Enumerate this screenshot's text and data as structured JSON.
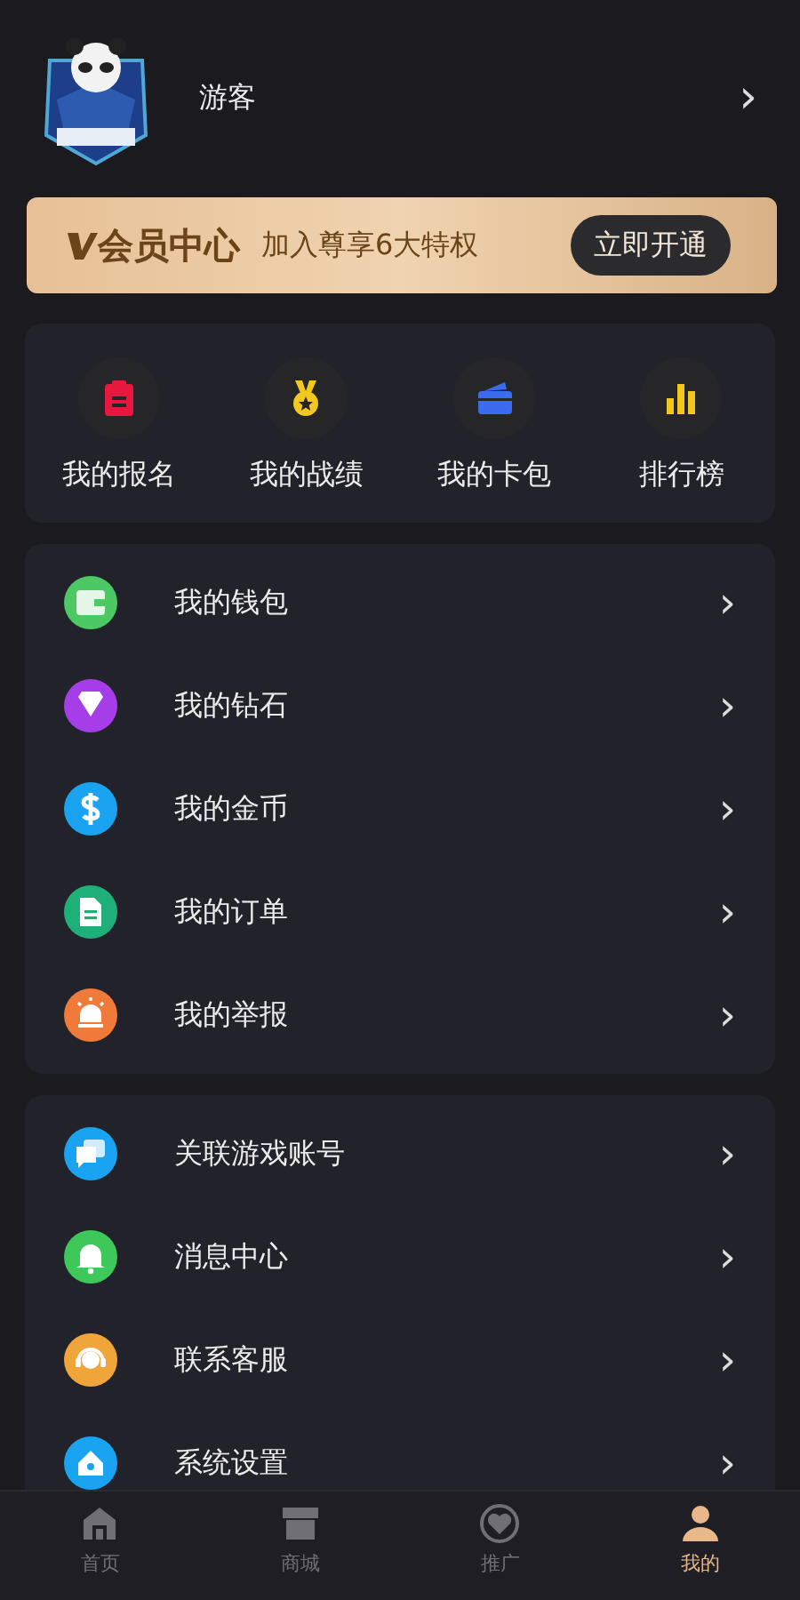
{
  "profile": {
    "name": "游客",
    "chevron": "›"
  },
  "vip_banner": {
    "title": "会员中心",
    "subtitle": "加入尊享6大特权",
    "button": "立即开通"
  },
  "shortcuts": [
    {
      "label": "我的报名",
      "color": "#e8173f"
    },
    {
      "label": "我的战绩",
      "color": "#f2c81f"
    },
    {
      "label": "我的卡包",
      "color": "#3b6cf0"
    },
    {
      "label": "排行榜",
      "color": "#f2c81f"
    }
  ],
  "menu_groups": [
    {
      "items": [
        {
          "label": "我的钱包",
          "color": "#4cc864"
        },
        {
          "label": "我的钻石",
          "color": "#a53ee8"
        },
        {
          "label": "我的金币",
          "color": "#1aa3f0"
        },
        {
          "label": "我的订单",
          "color": "#1fb07a"
        },
        {
          "label": "我的举报",
          "color": "#f07a3a"
        }
      ]
    },
    {
      "items": [
        {
          "label": "关联游戏账号",
          "color": "#1aa3f0"
        },
        {
          "label": "消息中心",
          "color": "#3ec85a"
        },
        {
          "label": "联系客服",
          "color": "#f0a53a"
        },
        {
          "label": "系统设置",
          "color": "#1aa3f0"
        }
      ]
    }
  ],
  "tab_bar": [
    {
      "label": "首页",
      "selected": false
    },
    {
      "label": "商城",
      "selected": false
    },
    {
      "label": "推广",
      "selected": false
    },
    {
      "label": "我的",
      "selected": true
    }
  ]
}
